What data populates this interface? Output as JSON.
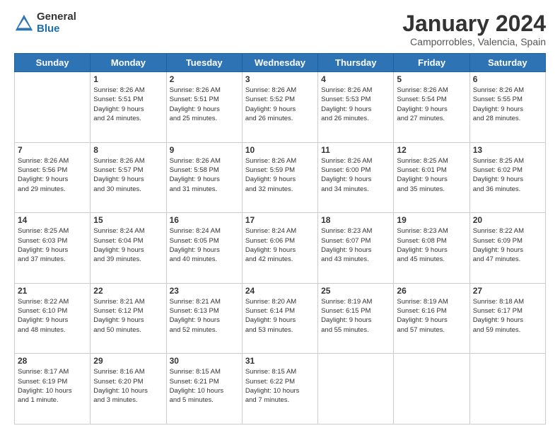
{
  "logo": {
    "general": "General",
    "blue": "Blue"
  },
  "header": {
    "title": "January 2024",
    "subtitle": "Camporrobles, Valencia, Spain"
  },
  "days_of_week": [
    "Sunday",
    "Monday",
    "Tuesday",
    "Wednesday",
    "Thursday",
    "Friday",
    "Saturday"
  ],
  "weeks": [
    [
      {
        "day": "",
        "info": ""
      },
      {
        "day": "1",
        "info": "Sunrise: 8:26 AM\nSunset: 5:51 PM\nDaylight: 9 hours\nand 24 minutes."
      },
      {
        "day": "2",
        "info": "Sunrise: 8:26 AM\nSunset: 5:51 PM\nDaylight: 9 hours\nand 25 minutes."
      },
      {
        "day": "3",
        "info": "Sunrise: 8:26 AM\nSunset: 5:52 PM\nDaylight: 9 hours\nand 26 minutes."
      },
      {
        "day": "4",
        "info": "Sunrise: 8:26 AM\nSunset: 5:53 PM\nDaylight: 9 hours\nand 26 minutes."
      },
      {
        "day": "5",
        "info": "Sunrise: 8:26 AM\nSunset: 5:54 PM\nDaylight: 9 hours\nand 27 minutes."
      },
      {
        "day": "6",
        "info": "Sunrise: 8:26 AM\nSunset: 5:55 PM\nDaylight: 9 hours\nand 28 minutes."
      }
    ],
    [
      {
        "day": "7",
        "info": "Sunrise: 8:26 AM\nSunset: 5:56 PM\nDaylight: 9 hours\nand 29 minutes."
      },
      {
        "day": "8",
        "info": "Sunrise: 8:26 AM\nSunset: 5:57 PM\nDaylight: 9 hours\nand 30 minutes."
      },
      {
        "day": "9",
        "info": "Sunrise: 8:26 AM\nSunset: 5:58 PM\nDaylight: 9 hours\nand 31 minutes."
      },
      {
        "day": "10",
        "info": "Sunrise: 8:26 AM\nSunset: 5:59 PM\nDaylight: 9 hours\nand 32 minutes."
      },
      {
        "day": "11",
        "info": "Sunrise: 8:26 AM\nSunset: 6:00 PM\nDaylight: 9 hours\nand 34 minutes."
      },
      {
        "day": "12",
        "info": "Sunrise: 8:25 AM\nSunset: 6:01 PM\nDaylight: 9 hours\nand 35 minutes."
      },
      {
        "day": "13",
        "info": "Sunrise: 8:25 AM\nSunset: 6:02 PM\nDaylight: 9 hours\nand 36 minutes."
      }
    ],
    [
      {
        "day": "14",
        "info": "Sunrise: 8:25 AM\nSunset: 6:03 PM\nDaylight: 9 hours\nand 37 minutes."
      },
      {
        "day": "15",
        "info": "Sunrise: 8:24 AM\nSunset: 6:04 PM\nDaylight: 9 hours\nand 39 minutes."
      },
      {
        "day": "16",
        "info": "Sunrise: 8:24 AM\nSunset: 6:05 PM\nDaylight: 9 hours\nand 40 minutes."
      },
      {
        "day": "17",
        "info": "Sunrise: 8:24 AM\nSunset: 6:06 PM\nDaylight: 9 hours\nand 42 minutes."
      },
      {
        "day": "18",
        "info": "Sunrise: 8:23 AM\nSunset: 6:07 PM\nDaylight: 9 hours\nand 43 minutes."
      },
      {
        "day": "19",
        "info": "Sunrise: 8:23 AM\nSunset: 6:08 PM\nDaylight: 9 hours\nand 45 minutes."
      },
      {
        "day": "20",
        "info": "Sunrise: 8:22 AM\nSunset: 6:09 PM\nDaylight: 9 hours\nand 47 minutes."
      }
    ],
    [
      {
        "day": "21",
        "info": "Sunrise: 8:22 AM\nSunset: 6:10 PM\nDaylight: 9 hours\nand 48 minutes."
      },
      {
        "day": "22",
        "info": "Sunrise: 8:21 AM\nSunset: 6:12 PM\nDaylight: 9 hours\nand 50 minutes."
      },
      {
        "day": "23",
        "info": "Sunrise: 8:21 AM\nSunset: 6:13 PM\nDaylight: 9 hours\nand 52 minutes."
      },
      {
        "day": "24",
        "info": "Sunrise: 8:20 AM\nSunset: 6:14 PM\nDaylight: 9 hours\nand 53 minutes."
      },
      {
        "day": "25",
        "info": "Sunrise: 8:19 AM\nSunset: 6:15 PM\nDaylight: 9 hours\nand 55 minutes."
      },
      {
        "day": "26",
        "info": "Sunrise: 8:19 AM\nSunset: 6:16 PM\nDaylight: 9 hours\nand 57 minutes."
      },
      {
        "day": "27",
        "info": "Sunrise: 8:18 AM\nSunset: 6:17 PM\nDaylight: 9 hours\nand 59 minutes."
      }
    ],
    [
      {
        "day": "28",
        "info": "Sunrise: 8:17 AM\nSunset: 6:19 PM\nDaylight: 10 hours\nand 1 minute."
      },
      {
        "day": "29",
        "info": "Sunrise: 8:16 AM\nSunset: 6:20 PM\nDaylight: 10 hours\nand 3 minutes."
      },
      {
        "day": "30",
        "info": "Sunrise: 8:15 AM\nSunset: 6:21 PM\nDaylight: 10 hours\nand 5 minutes."
      },
      {
        "day": "31",
        "info": "Sunrise: 8:15 AM\nSunset: 6:22 PM\nDaylight: 10 hours\nand 7 minutes."
      },
      {
        "day": "",
        "info": ""
      },
      {
        "day": "",
        "info": ""
      },
      {
        "day": "",
        "info": ""
      }
    ]
  ]
}
